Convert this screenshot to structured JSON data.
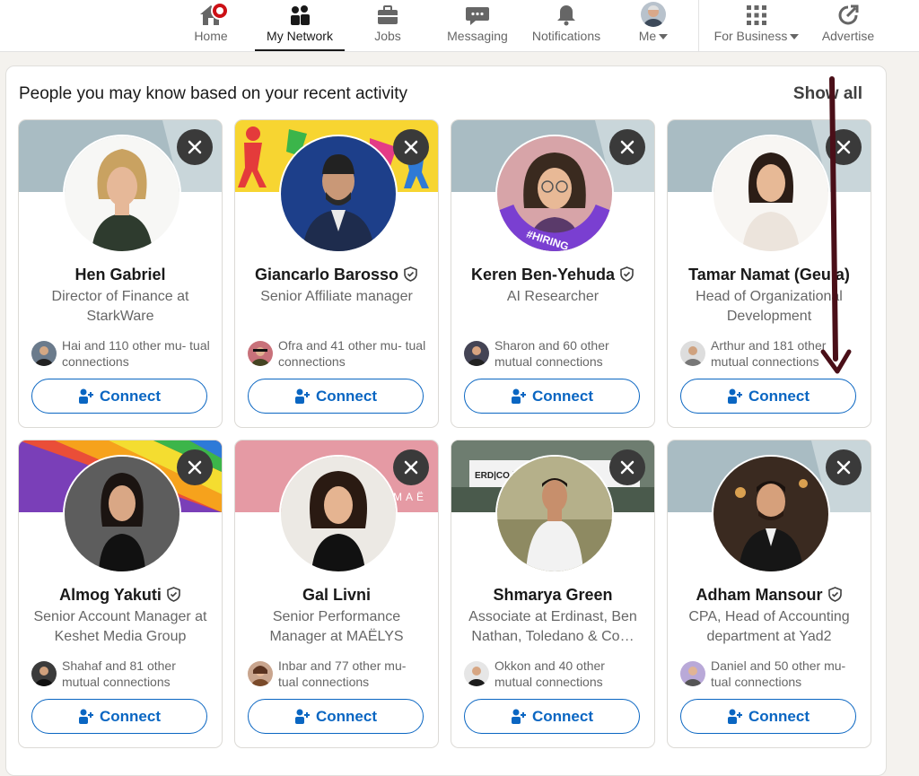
{
  "nav": {
    "items": [
      {
        "key": "home",
        "label": "Home"
      },
      {
        "key": "network",
        "label": "My Network"
      },
      {
        "key": "jobs",
        "label": "Jobs"
      },
      {
        "key": "messaging",
        "label": "Messaging"
      },
      {
        "key": "notifications",
        "label": "Notifications"
      },
      {
        "key": "me",
        "label": "Me"
      },
      {
        "key": "business",
        "label": "For Business"
      },
      {
        "key": "advertise",
        "label": "Advertise"
      }
    ],
    "active": "My Network"
  },
  "section": {
    "title": "People you may know based on your recent activity",
    "show_all": "Show all"
  },
  "cards": [
    {
      "name": "Hen Gabriel",
      "verified": false,
      "headline": "Director of Finance at StarkWare",
      "mutual": "Hai and 110 other mu- tual connections",
      "connect": "Connect"
    },
    {
      "name": "Giancarlo Barosso",
      "verified": true,
      "headline": "Senior Affiliate manager",
      "mutual": "Ofra and 41 other mu- tual connections",
      "connect": "Connect"
    },
    {
      "name": "Keren Ben-Yehuda",
      "verified": true,
      "headline": "AI Researcher",
      "mutual": "Sharon and 60 other mutual connections",
      "connect": "Connect",
      "avatar_frame_text": "#HIRING"
    },
    {
      "name": "Tamar Namat (Geula)",
      "verified": false,
      "headline": "Head of Organizational Development",
      "mutual": "Arthur and 181 other mutual connections",
      "connect": "Connect"
    },
    {
      "name": "Almog Yakuti",
      "verified": true,
      "headline": "Senior Account Manager at Keshet Media Group",
      "mutual": "Shahaf and 81 other mutual connections",
      "connect": "Connect"
    },
    {
      "name": "Gal Livni",
      "verified": false,
      "headline": "Senior Performance Manager at MAËLYS",
      "mutual": "Inbar and 77 other mu- tual connections",
      "connect": "Connect",
      "banner_text": "MAË"
    },
    {
      "name": "Shmarya Green",
      "verified": false,
      "headline": "Associate at Erdinast, Ben Nathan, Toledano & Co…",
      "mutual": "Okkon and 40 other mutual connections",
      "connect": "Connect",
      "banner_text": "ERD|CO | Er"
    },
    {
      "name": "Adham Mansour",
      "verified": true,
      "headline": "CPA, Head of Accounting department at Yad2",
      "mutual": "Daniel and 50 other mu- tual connections",
      "connect": "Connect"
    }
  ],
  "colors": {
    "brand_blue": "#0a66c2",
    "badge_red": "#cc1016",
    "arrow": "#4a0f18"
  }
}
